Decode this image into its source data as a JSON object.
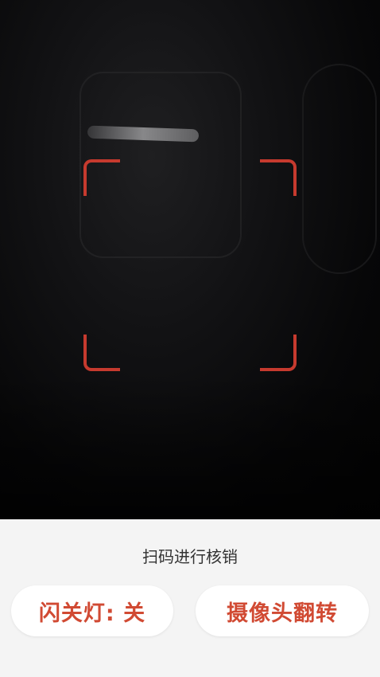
{
  "scanner": {
    "hint_text": "扫码进行核销",
    "frame_color": "#c63a2e"
  },
  "buttons": {
    "flashlight_label": "闪关灯: 关",
    "flip_camera_label": "摄像头翻转",
    "text_color": "#d14a33"
  }
}
